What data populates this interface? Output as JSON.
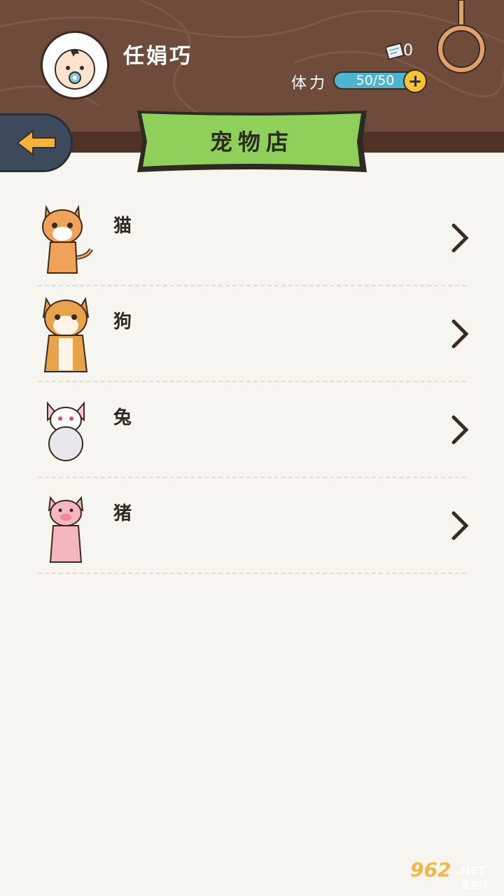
{
  "header": {
    "username": "任娟巧",
    "ticket_count": "0",
    "stamina_label": "体力",
    "stamina_value": "50/50"
  },
  "banner": {
    "title": "宠物店"
  },
  "pets": [
    {
      "name": "猫",
      "icon": "cat-icon"
    },
    {
      "name": "狗",
      "icon": "dog-icon"
    },
    {
      "name": "兔",
      "icon": "rabbit-icon"
    },
    {
      "name": "猪",
      "icon": "pig-icon"
    }
  ],
  "watermark": {
    "brand": "962",
    "suffix": ".NET",
    "sub": "乐游网"
  },
  "colors": {
    "header_bg": "#6e4b3a",
    "banner_green": "#8fd05a",
    "stamina_blue": "#4db3ce",
    "accent_yellow": "#f5c43b",
    "page_bg": "#f7f5ef"
  }
}
